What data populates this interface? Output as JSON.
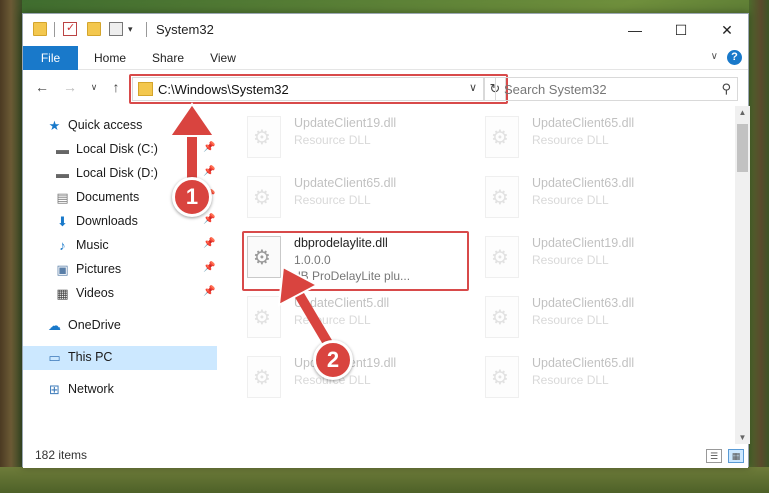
{
  "window": {
    "title": "System32",
    "controls": {
      "minimize": "—",
      "maximize": "☐",
      "close": "✕"
    }
  },
  "ribbon": {
    "tabs": [
      "File",
      "Home",
      "Share",
      "View"
    ],
    "help": "?"
  },
  "nav": {
    "address": "C:\\Windows\\System32",
    "search_placeholder": "Search System32"
  },
  "sidebar": {
    "items": [
      {
        "label": "Quick access",
        "icon": "star-icon",
        "pinned": false
      },
      {
        "label": "Local Disk (C:)",
        "icon": "drive-icon",
        "pinned": true
      },
      {
        "label": "Local Disk (D:)",
        "icon": "drive-icon",
        "pinned": true
      },
      {
        "label": "Documents",
        "icon": "documents-icon",
        "pinned": true
      },
      {
        "label": "Downloads",
        "icon": "download-icon",
        "pinned": true
      },
      {
        "label": "Music",
        "icon": "music-icon",
        "pinned": true
      },
      {
        "label": "Pictures",
        "icon": "pictures-icon",
        "pinned": true
      },
      {
        "label": "Videos",
        "icon": "videos-icon",
        "pinned": true
      },
      {
        "label": "OneDrive",
        "icon": "cloud-icon",
        "pinned": false
      },
      {
        "label": "This PC",
        "icon": "computer-icon",
        "pinned": false,
        "selected": true
      },
      {
        "label": "Network",
        "icon": "network-icon",
        "pinned": false
      }
    ]
  },
  "files": [
    {
      "name": "UpdateClient19.dll",
      "sub": "Resource DLL",
      "faded": true
    },
    {
      "name": "UpdateClient65.dll",
      "sub": "Resource DLL",
      "faded": true
    },
    {
      "name": "UpdateClient65.dll",
      "sub": "Resource DLL",
      "faded": true
    },
    {
      "name": "UpdateClient63.dll",
      "sub": "Resource DLL",
      "faded": true
    },
    {
      "name": "dbprodelaylite.dll",
      "sub": "1.0.0.0",
      "sub2": "dB ProDelayLite plu...",
      "faded": false
    },
    {
      "name": "UpdateClient19.dll",
      "sub": "Resource DLL",
      "faded": true
    },
    {
      "name": "UpdateClient5.dll",
      "sub": "Resource DLL",
      "faded": true
    },
    {
      "name": "UpdateClient63.dll",
      "sub": "Resource DLL",
      "faded": true
    },
    {
      "name": "UpdateClient19.dll",
      "sub": "Resource DLL",
      "faded": true
    },
    {
      "name": "UpdateClient65.dll",
      "sub": "Resource DLL",
      "faded": true
    }
  ],
  "status": {
    "item_count": "182 items"
  },
  "annotations": {
    "step1": "1",
    "step2": "2"
  },
  "colors": {
    "accent": "#1979ca",
    "highlight": "#d84a4a",
    "selected": "#cce8ff"
  }
}
